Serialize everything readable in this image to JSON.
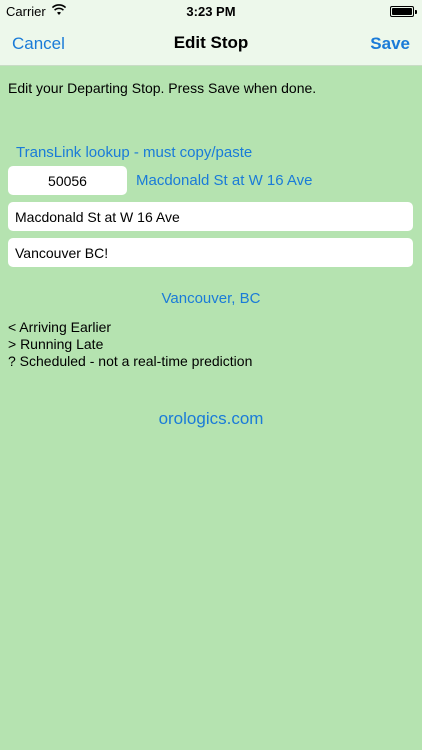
{
  "status_bar": {
    "carrier": "Carrier",
    "time": "3:23 PM",
    "battery_level": 1.0
  },
  "nav_bar": {
    "cancel_label": "Cancel",
    "title": "Edit Stop",
    "save_label": "Save"
  },
  "instructions": "Edit your Departing Stop. Press Save when done.",
  "lookup_link": "TransLink lookup - must copy/paste",
  "stop": {
    "number_value": "50056",
    "name_link": "Macdonald St at W 16 Ave",
    "description_value": "Macdonald St at W 16 Ave",
    "city_value": "Vancouver BC!"
  },
  "city_label": "Vancouver, BC",
  "legend": {
    "arriving_earlier": "< Arriving Earlier",
    "running_late": "> Running Late",
    "scheduled": "? Scheduled - not a real-time prediction"
  },
  "website_link": "orologics.com",
  "colors": {
    "background": "#b5e3b0",
    "bar_background": "#edf8eb",
    "accent": "#1a7bd8"
  }
}
